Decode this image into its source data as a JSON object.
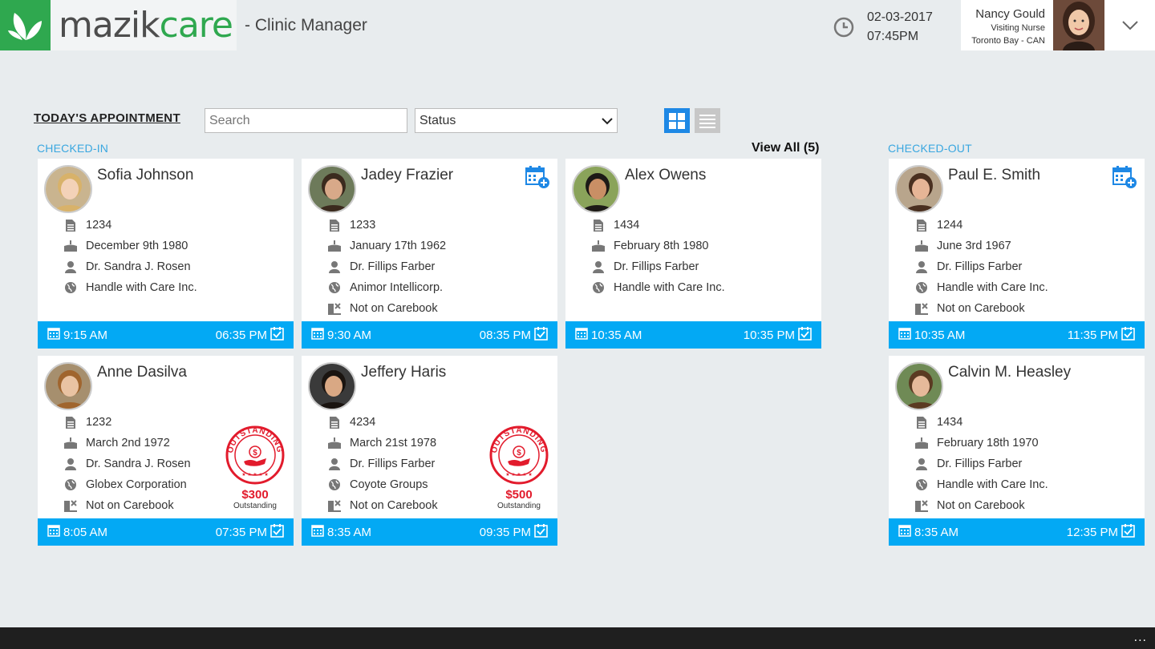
{
  "header": {
    "logo_mazik": "mazik",
    "logo_care": "care",
    "app_title": "- Clinic Manager",
    "date": "02-03-2017",
    "time": "07:45PM",
    "user": {
      "name": "Nancy Gould",
      "role": "Visiting Nurse",
      "location": "Toronto Bay - CAN"
    }
  },
  "toolbar": {
    "title": "TODAY'S APPOINTMENT",
    "search_placeholder": "Search",
    "status_label": "Status"
  },
  "sections": {
    "checked_in": "CHECKED-IN",
    "checked_out": "CHECKED-OUT",
    "view_all": "View All (5)"
  },
  "colors": {
    "accent": "#03a9f4",
    "brand_green": "#2fa84f",
    "stamp_red": "#e21b2c"
  },
  "checked_in": [
    {
      "name": "Sofia Johnson",
      "id": "1234",
      "dob": "December 9th 1980",
      "doctor": "Dr. Sandra J. Rosen",
      "insurance": "Handle with Care Inc.",
      "start": "9:15 AM",
      "end": "06:35 PM"
    },
    {
      "name": "Jadey Frazier",
      "id": "1233",
      "dob": "January 17th 1962",
      "doctor": "Dr. Fillips Farber",
      "insurance": "Animor Intellicorp.",
      "carebook": "Not on Carebook",
      "start": "9:30 AM",
      "end": "08:35 PM"
    },
    {
      "name": "Alex Owens",
      "id": "1434",
      "dob": "February 8th 1980",
      "doctor": "Dr. Fillips Farber",
      "insurance": "Handle with Care Inc.",
      "start": "10:35 AM",
      "end": "10:35 PM"
    },
    {
      "name": "Anne Dasilva",
      "id": "1232",
      "dob": "March 2nd 1972",
      "doctor": "Dr. Sandra J. Rosen",
      "insurance": "Globex Corporation",
      "carebook": "Not on Carebook",
      "outstanding_amount": "$300",
      "outstanding_label": "Outstanding",
      "stamp_text": "OUTSTANDING",
      "start": "8:05 AM",
      "end": "07:35 PM"
    },
    {
      "name": "Jeffery Haris",
      "id": "4234",
      "dob": "March 21st 1978",
      "doctor": "Dr. Fillips Farber",
      "insurance": "Coyote Groups",
      "carebook": "Not on Carebook",
      "outstanding_amount": "$500",
      "outstanding_label": "Outstanding",
      "stamp_text": "OUTSTANDING",
      "start": "8:35 AM",
      "end": "09:35 PM"
    }
  ],
  "checked_out": [
    {
      "name": "Paul E. Smith",
      "id": "1244",
      "dob": "June 3rd 1967",
      "doctor": "Dr. Fillips Farber",
      "insurance": "Handle with Care Inc.",
      "carebook": "Not on Carebook",
      "start": "10:35 AM",
      "end": "11:35 PM"
    },
    {
      "name": "Calvin M. Heasley",
      "id": "1434",
      "dob": "February 18th 1970",
      "doctor": "Dr. Fillips Farber",
      "insurance": "Handle with Care Inc.",
      "carebook": "Not on Carebook",
      "start": "8:35 AM",
      "end": "12:35 PM"
    }
  ],
  "taskbar": {
    "more": "..."
  }
}
